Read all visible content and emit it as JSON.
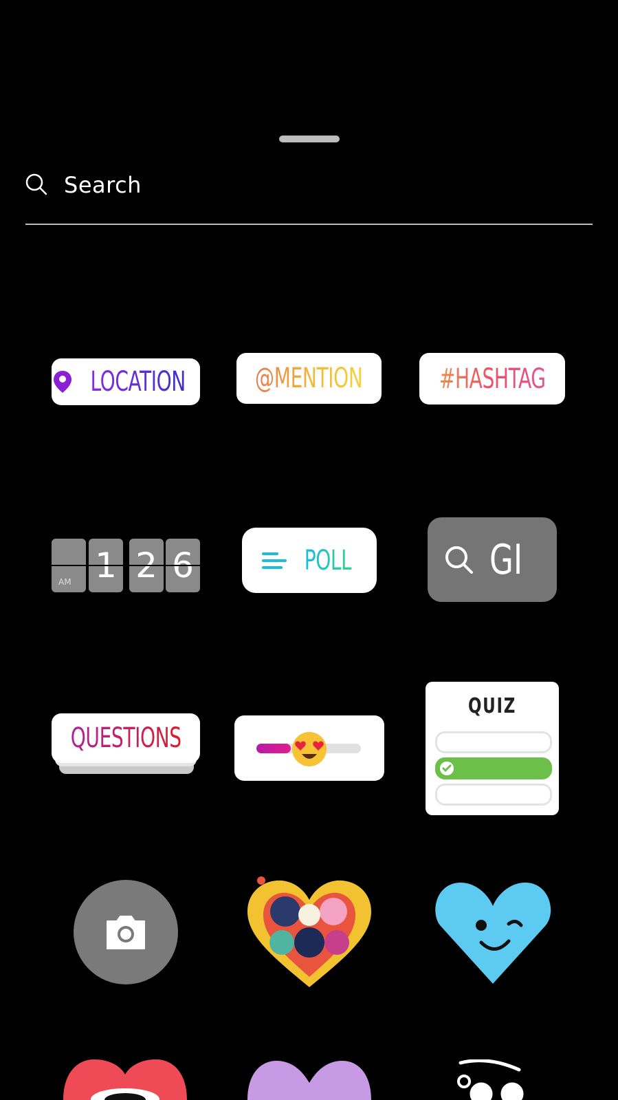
{
  "search": {
    "placeholder": "Search"
  },
  "stickers": {
    "location": "LOCATION",
    "mention": "@MENTION",
    "hashtag": "#HASHTAG",
    "clock": {
      "digits": [
        "",
        "1",
        "2",
        "6"
      ],
      "period": "AM"
    },
    "poll": "POLL",
    "gif": "GI",
    "questions": "QUESTIONS",
    "emoji_slider": {
      "value": 0.33,
      "emoji": "heart-eyes-emoji"
    },
    "quiz": {
      "title": "QUIZ",
      "correct_option": 2
    },
    "camera": "camera-icon",
    "colors": {
      "location": "#5b2fd0",
      "poll": "#1bbcdc",
      "quiz_correct": "#6cc04a",
      "gif_bg": "#757575",
      "camera_bg": "#7a7a7a"
    }
  }
}
